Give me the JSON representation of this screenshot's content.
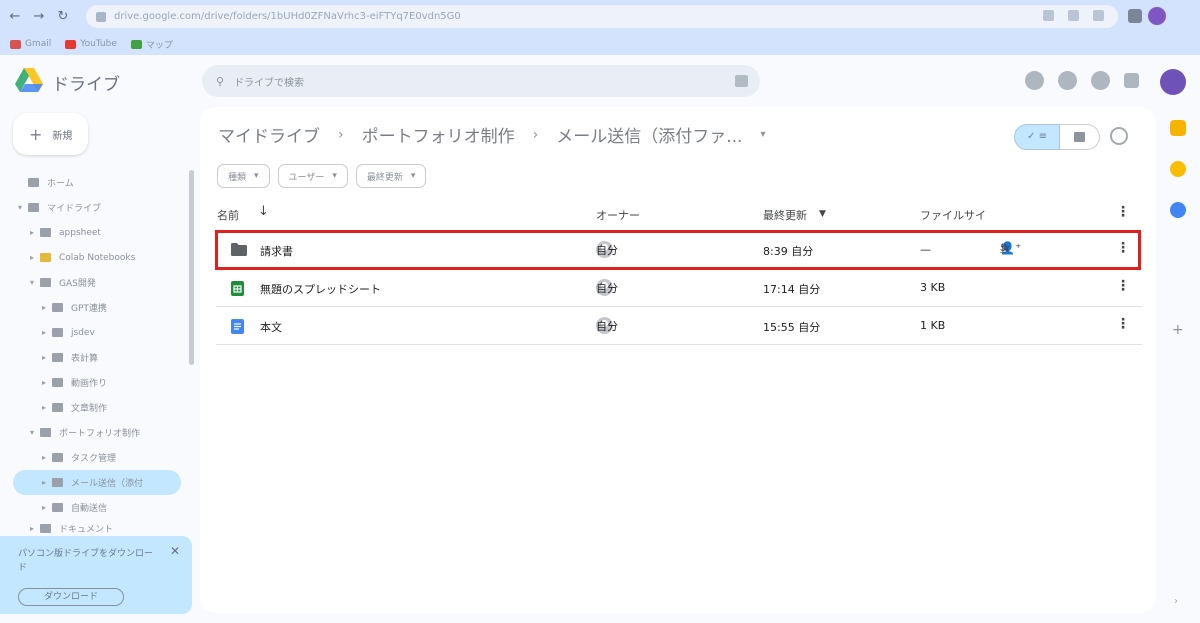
{
  "browser": {
    "url": "drive.google.com/drive/folders/1bUHd0ZFNaVrhc3-eiFTYq7E0vdn5G0",
    "bookmarks": [
      "Gmail",
      "YouTube",
      "マップ"
    ]
  },
  "drive": {
    "logo_text": "ドライブ",
    "search_placeholder": "ドライブで検索",
    "new_button": "新規"
  },
  "sidebar": {
    "items": [
      {
        "label": "ホーム",
        "depth": 0
      },
      {
        "label": "マイドライブ",
        "depth": 0
      },
      {
        "label": "appsheet",
        "depth": 1
      },
      {
        "label": "Colab Notebooks",
        "depth": 1
      },
      {
        "label": "GAS開発",
        "depth": 1
      },
      {
        "label": "GPT連携",
        "depth": 2
      },
      {
        "label": "jsdev",
        "depth": 2
      },
      {
        "label": "表計算",
        "depth": 2
      },
      {
        "label": "動画作り",
        "depth": 2
      },
      {
        "label": "文章制作",
        "depth": 2
      },
      {
        "label": "ポートフォリオ制作",
        "depth": 1
      },
      {
        "label": "タスク管理",
        "depth": 2
      },
      {
        "label": "メール送信（添付",
        "depth": 2,
        "active": true
      },
      {
        "label": "自動送信",
        "depth": 2
      },
      {
        "label": "ドキュメント",
        "depth": 1
      }
    ],
    "promo_text": "パソコン版ドライブをダウンロード",
    "promo_button": "ダウンロード"
  },
  "main": {
    "breadcrumb": [
      "マイドライブ",
      "ポートフォリオ制作",
      "メール送信（添付ファ..."
    ],
    "view_list": "✓ ≡",
    "filters": [
      "種類",
      "ユーザー",
      "最終更新"
    ],
    "columns": {
      "name": "名前",
      "owner": "オーナー",
      "modified": "最終更新",
      "size": "ファイルサイ"
    },
    "rows": [
      {
        "name": "請求書",
        "type": "folder",
        "owner": "自分",
        "modified": "8:39 自分",
        "size": "—",
        "selected": true
      },
      {
        "name": "無題のスプレッドシート",
        "type": "sheet",
        "owner": "自分",
        "modified": "17:14 自分",
        "size": "3 KB"
      },
      {
        "name": "本文",
        "type": "doc",
        "owner": "自分",
        "modified": "15:55 自分",
        "size": "1 KB"
      }
    ]
  },
  "colors": {
    "accent": "#c2e7ff",
    "highlight_border": "#e0201c",
    "sheets_green": "#1e8e3e",
    "docs_blue": "#4285f4"
  }
}
